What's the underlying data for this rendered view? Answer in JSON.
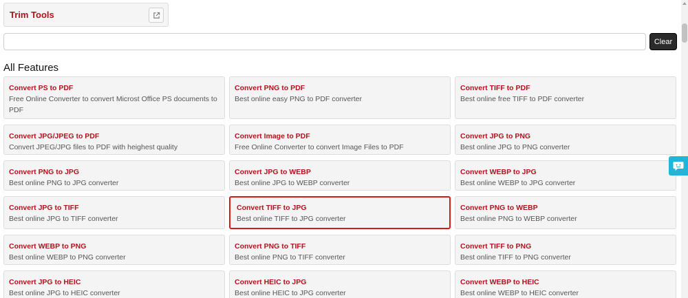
{
  "header": {
    "title": "Trim Tools",
    "external_icon": "external-link-icon"
  },
  "search": {
    "value": "",
    "placeholder": "",
    "clear_label": "Clear"
  },
  "section_title": "All Features",
  "features": [
    {
      "title": "Convert PS to PDF",
      "desc": "Free Online Converter to convert Microst Office PS documents to PDF"
    },
    {
      "title": "Convert PNG to PDF",
      "desc": "Best online easy PNG to PDF converter"
    },
    {
      "title": "Convert TIFF to PDF",
      "desc": "Best online free TIFF to PDF converter"
    },
    {
      "title": "Convert JPG/JPEG to PDF",
      "desc": "Convert JPEG/JPG files to PDF with heighest quality"
    },
    {
      "title": "Convert Image to PDF",
      "desc": "Free Online Converter to convert Image Files to PDF"
    },
    {
      "title": "Convert JPG to PNG",
      "desc": "Best online JPG to PNG converter"
    },
    {
      "title": "Convert PNG to JPG",
      "desc": "Best online PNG to JPG converter"
    },
    {
      "title": "Convert JPG to WEBP",
      "desc": "Best online JPG to WEBP converter"
    },
    {
      "title": "Convert WEBP to JPG",
      "desc": "Best online WEBP to JPG converter"
    },
    {
      "title": "Convert JPG to TIFF",
      "desc": "Best online JPG to TIFF converter"
    },
    {
      "title": "Convert TIFF to JPG",
      "desc": "Best online TIFF to JPG converter"
    },
    {
      "title": "Convert PNG to WEBP",
      "desc": "Best online PNG to WEBP converter"
    },
    {
      "title": "Convert WEBP to PNG",
      "desc": "Best online WEBP to PNG converter"
    },
    {
      "title": "Convert PNG to TIFF",
      "desc": "Best online PNG to TIFF converter"
    },
    {
      "title": "Convert TIFF to PNG",
      "desc": "Best online TIFF to PNG converter"
    },
    {
      "title": "Convert JPG to HEIC",
      "desc": "Best online JPG to HEIC converter"
    },
    {
      "title": "Convert HEIC to JPG",
      "desc": "Best online HEIC to JPG converter"
    },
    {
      "title": "Convert WEBP to HEIC",
      "desc": "Best online WEBP to HEIC converter"
    }
  ],
  "chat_icon": "chat-bubble-icon",
  "colors": {
    "accent": "#b3121a",
    "highlight_border": "#d21b1b",
    "chat": "#21b5d9"
  }
}
